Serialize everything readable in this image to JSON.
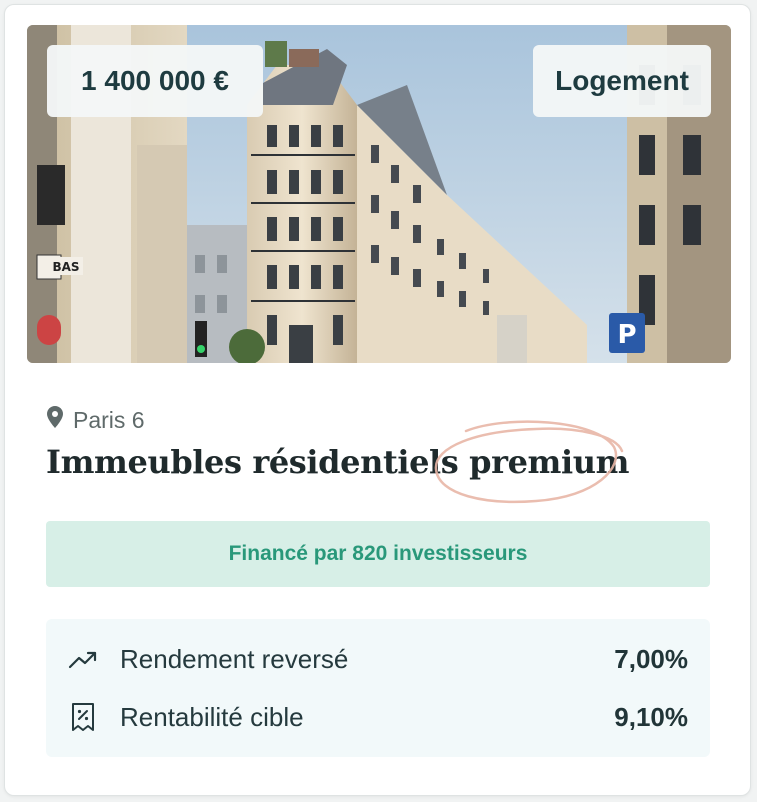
{
  "listing": {
    "price": "1 400 000 €",
    "category": "Logement",
    "location": "Paris 6",
    "title": "Immeubles résidentiels premium",
    "funded_text": "Financé par 820 investisseurs",
    "photo_signs": {
      "shop_sign": "BAS",
      "parking_sign": "P"
    },
    "stats": [
      {
        "icon": "trending-up-icon",
        "label": "Rendement reversé",
        "value": "7,00%"
      },
      {
        "icon": "receipt-percent-icon",
        "label": "Rentabilité cible",
        "value": "9,10%"
      }
    ]
  },
  "colors": {
    "accent_green": "#29987a",
    "funded_bg": "#d7efe7",
    "stats_bg": "#f2f9fa",
    "text_dark": "#1f2a2c",
    "scribble": "#e8b6a6"
  }
}
